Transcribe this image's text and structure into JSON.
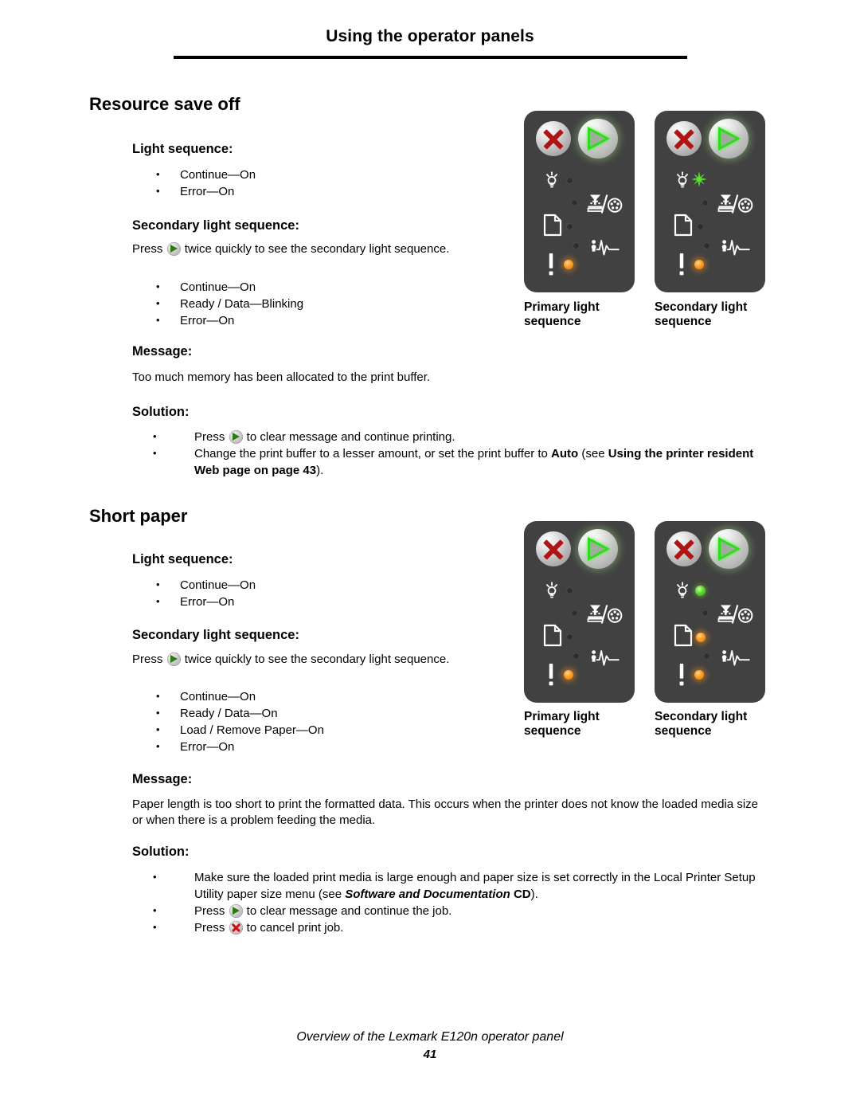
{
  "header": {
    "title": "Using the operator panels"
  },
  "sections": [
    {
      "title": "Resource save off",
      "light_sequence_label": "Light sequence:",
      "light_sequence_items": [
        "Continue—On",
        "Error—On"
      ],
      "secondary_label": "Secondary light sequence:",
      "secondary_intro_before": "Press",
      "secondary_intro_after": "twice quickly to see the secondary light sequence.",
      "secondary_items": [
        "Continue—On",
        "Ready / Data—Blinking",
        "Error—On"
      ],
      "message_label": "Message:",
      "message_text": "Too much memory has been allocated to the print buffer.",
      "solution_label": "Solution:",
      "solutions": [
        {
          "parts": [
            {
              "t": "Press ",
              "style": "normal"
            },
            {
              "t": "ICON_CONTINUE",
              "style": "icon"
            },
            {
              "t": " to clear message and continue printing.",
              "style": "normal"
            }
          ]
        },
        {
          "parts": [
            {
              "t": "Change the print buffer to a lesser amount, or set the print buffer to ",
              "style": "normal"
            },
            {
              "t": "Auto",
              "style": "bold"
            },
            {
              "t": " (see ",
              "style": "normal"
            },
            {
              "t": "Using the printer resident Web page on page 43",
              "style": "bold"
            },
            {
              "t": ").",
              "style": "normal"
            }
          ]
        }
      ],
      "figure": {
        "primary_caption": "Primary light sequence",
        "secondary_caption": "Secondary light sequence",
        "primary_leds": {
          "ready": "off",
          "toner": "off",
          "paper": "off",
          "jam": "off",
          "error": "orange"
        },
        "secondary_leds": {
          "ready": "blink-green",
          "toner": "off",
          "paper": "off",
          "jam": "off",
          "error": "orange"
        }
      }
    },
    {
      "title": "Short paper",
      "light_sequence_label": "Light sequence:",
      "light_sequence_items": [
        "Continue—On",
        "Error—On"
      ],
      "secondary_label": "Secondary light sequence:",
      "secondary_intro_before": "Press",
      "secondary_intro_after": "twice quickly to see the secondary light sequence.",
      "secondary_items": [
        "Continue—On",
        "Ready / Data—On",
        "Load / Remove Paper—On",
        "Error—On"
      ],
      "message_label": "Message:",
      "message_text": "Paper length is too short to print the formatted data. This occurs when the printer does not know the loaded media size or when there is a problem feeding the media.",
      "solution_label": "Solution:",
      "solutions": [
        {
          "parts": [
            {
              "t": "Make sure the loaded print media is large enough and paper size is set correctly in the Local Printer Setup Utility paper size menu (see ",
              "style": "normal"
            },
            {
              "t": "Software and Documentation",
              "style": "bold-italic"
            },
            {
              "t": " CD",
              "style": "bold"
            },
            {
              "t": ").",
              "style": "normal"
            }
          ]
        },
        {
          "parts": [
            {
              "t": "Press ",
              "style": "normal"
            },
            {
              "t": "ICON_CONTINUE",
              "style": "icon"
            },
            {
              "t": " to clear message and continue the job.",
              "style": "normal"
            }
          ]
        },
        {
          "parts": [
            {
              "t": "Press ",
              "style": "normal"
            },
            {
              "t": "ICON_CANCEL",
              "style": "icon"
            },
            {
              "t": " to cancel print job.",
              "style": "normal"
            }
          ]
        }
      ],
      "figure": {
        "primary_caption": "Primary light sequence",
        "secondary_caption": "Secondary light sequence",
        "primary_leds": {
          "ready": "off",
          "toner": "off",
          "paper": "off",
          "jam": "off",
          "error": "orange"
        },
        "secondary_leds": {
          "ready": "green",
          "toner": "off",
          "paper": "orange",
          "jam": "off",
          "error": "orange"
        }
      }
    }
  ],
  "panel_icons": {
    "ready": "lamp-icon",
    "toner": "toner-low-icon",
    "paper": "paper-icon",
    "jam": "paper-jam-icon",
    "error": "error-icon",
    "cancel_button": "cancel-x-button",
    "continue_button": "continue-triangle-button"
  },
  "footer": {
    "line1": "Overview of the Lexmark E120n operator panel",
    "line2": "41"
  },
  "colors": {
    "panel_bg": "#414141",
    "led_orange": "#ff9b20",
    "led_green": "#5ed82c",
    "arrow_green": "#2fdb1f",
    "x_red": "#b01515"
  }
}
